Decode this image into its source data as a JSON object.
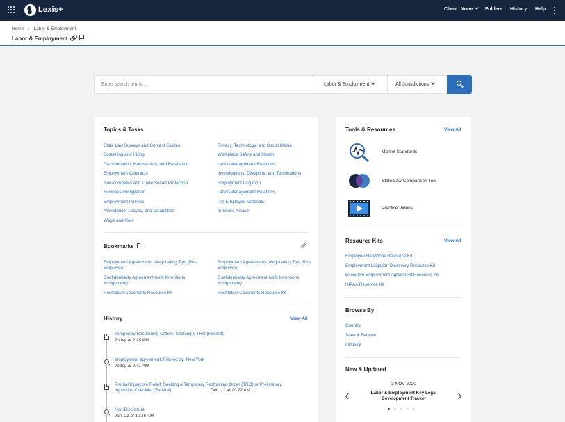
{
  "colors": {
    "header_bg": "#17263f",
    "accent": "#2a6ebb",
    "page_bg": "#f2f2f2"
  },
  "header": {
    "brand": "Lexis+",
    "client": "Client: None",
    "folders": "Folders",
    "history": "History",
    "help": "Help"
  },
  "breadcrumb": {
    "home": "Home",
    "current": "Labor & Employment"
  },
  "page_title": "Labor & Employment",
  "search": {
    "placeholder": "Enter search terms...",
    "practice_area": "Labor & Employment",
    "jurisdiction": "All Jurisdictions"
  },
  "topics": {
    "title": "Topics & Tasks",
    "col1": [
      "State Law Surveys and Content Guides",
      "Screening and Hiring",
      "Discrimination, Harassment, and Retaliation",
      "Employment Contracts",
      "Non-competes and Trade Secret Protection",
      "Business Immigration",
      "Employment Policies",
      "Attendance, Leaves, and Disabilities",
      "Wage and Hour"
    ],
    "col2": [
      "Privacy, Technology, and Social Media",
      "Workplace Safety and Health",
      "Labor-Management Relations",
      "Investigations, Discipline, and Terminations",
      "Employment Litigation",
      "Labor-Management Relations",
      "Pro-Employee Materials",
      "In-house Advisor"
    ]
  },
  "bookmarks": {
    "title": "Bookmarks",
    "items": [
      "Employment Agreements: Negotiating Tips (Pro-Employee)",
      "Employment Agreements: Negotiating Tips (Pro-Employee)",
      "Confidentiality Agreement (with Inventions Assignment)",
      "Confidentiality Agreement (with Inventions Assignment)",
      "Restrictive Covenants Resource Kit",
      "Restrictive Covenants Resource Kit"
    ]
  },
  "history": {
    "title": "History",
    "view_all": "View All",
    "items": [
      {
        "title": "Temporary Restraining Orders: Seeking a TRO (Federal)",
        "meta": "Today at 2:15 PM.",
        "icon": "document-icon"
      },
      {
        "title": "employment agreement, Filtered by: New York",
        "meta": "Today at 9:41 AM.",
        "icon": "search-icon"
      },
      {
        "title": "Pretrial Injunctive Relief: Seeking a Temporary Restraining Order (TRO) or Preliminary Injunction Checklist (Federal)",
        "meta": "Dec. 11 at 10:22 AM.",
        "icon": "document-icon"
      },
      {
        "title": "Non-Disclosure",
        "meta": "Jan. 21 at 10:16 AM.",
        "icon": "search-icon"
      }
    ]
  },
  "tools": {
    "title": "Tools & Resources",
    "view_all": "View All",
    "items": [
      "Market Standards",
      "State Law Comparison Tool",
      "Practice Videos"
    ]
  },
  "resource_kits": {
    "title": "Resource Kits",
    "view_all": "View All",
    "items": [
      "Employee Handbook Resource Kit",
      "Employment Litigation Discovery Resource Kit",
      "Executive Employment Agreement Resource Kit",
      "HIPAA Resource Kit"
    ]
  },
  "browse": {
    "title": "Browse By",
    "items": [
      "Country",
      "State & Federal",
      "Industry"
    ]
  },
  "news": {
    "title": "New & Updated",
    "date": "3 NOV 2020",
    "headline": "Labor & Employment Key Legal Development Tracker",
    "slide_count": 5,
    "active_slide": 1
  }
}
